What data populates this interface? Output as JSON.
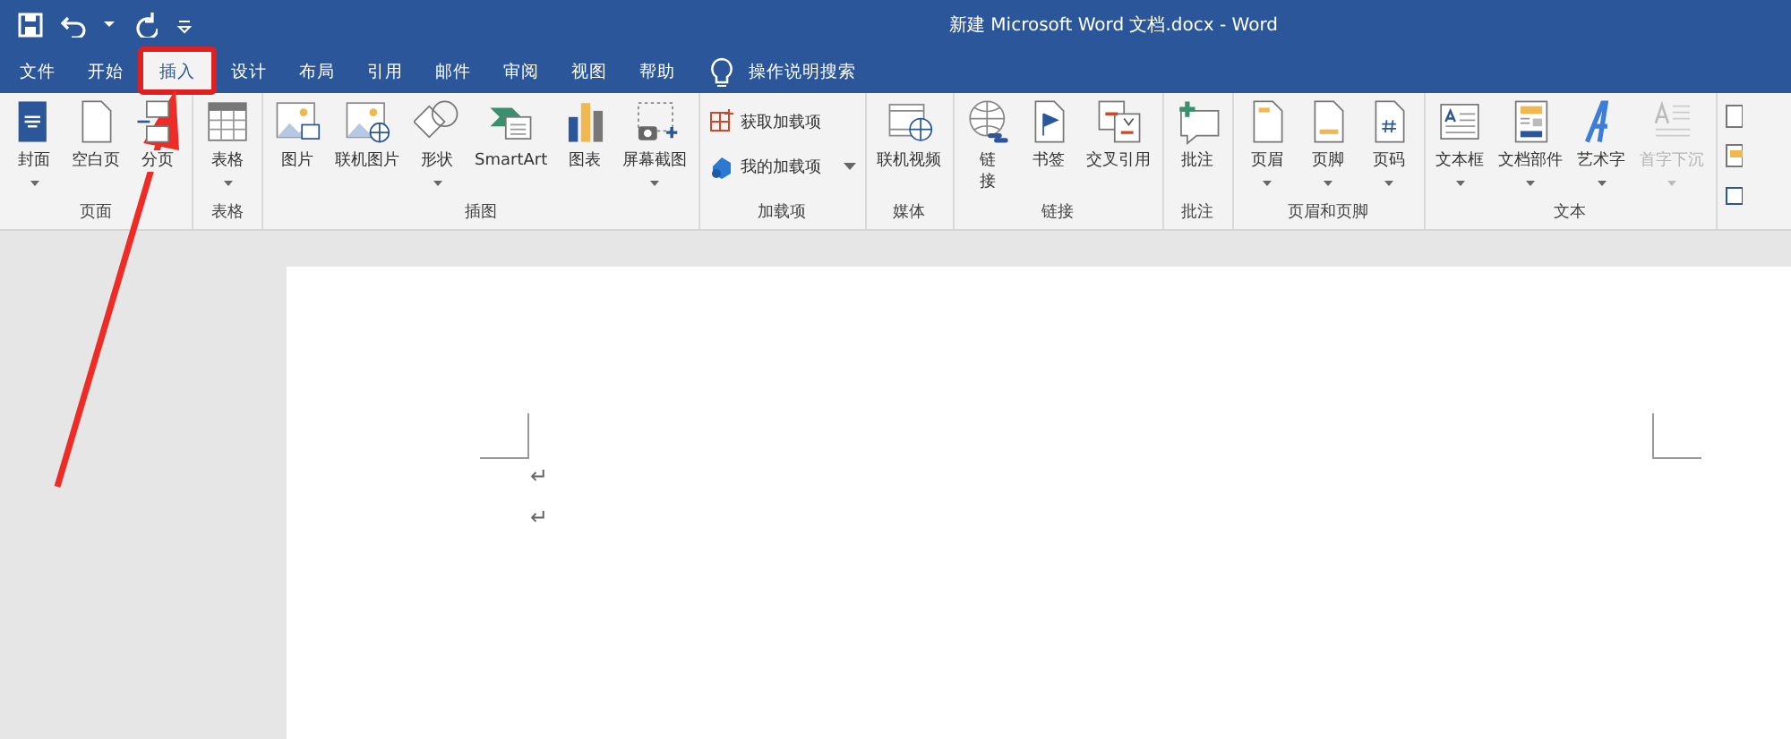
{
  "window": {
    "title": "新建 Microsoft Word 文档.docx  -  Word"
  },
  "tabs": [
    {
      "label": "文件",
      "selected": false,
      "highlighted": false
    },
    {
      "label": "开始",
      "selected": false,
      "highlighted": false
    },
    {
      "label": "插入",
      "selected": true,
      "highlighted": true
    },
    {
      "label": "设计",
      "selected": false,
      "highlighted": false
    },
    {
      "label": "布局",
      "selected": false,
      "highlighted": false
    },
    {
      "label": "引用",
      "selected": false,
      "highlighted": false
    },
    {
      "label": "邮件",
      "selected": false,
      "highlighted": false
    },
    {
      "label": "审阅",
      "selected": false,
      "highlighted": false
    },
    {
      "label": "视图",
      "selected": false,
      "highlighted": false
    },
    {
      "label": "帮助",
      "selected": false,
      "highlighted": false
    }
  ],
  "tell_me": {
    "placeholder": "操作说明搜索"
  },
  "ribbon_groups": [
    {
      "label": "页面",
      "buttons": [
        {
          "kind": "large",
          "label": "封面",
          "dropdown": true,
          "disabled": false
        },
        {
          "kind": "large",
          "label": "空白页",
          "dropdown": false,
          "disabled": false
        },
        {
          "kind": "large",
          "label": "分页",
          "dropdown": false,
          "disabled": false
        }
      ]
    },
    {
      "label": "表格",
      "buttons": [
        {
          "kind": "large",
          "label": "表格",
          "dropdown": true,
          "disabled": false
        }
      ]
    },
    {
      "label": "插图",
      "buttons": [
        {
          "kind": "large",
          "label": "图片",
          "dropdown": false,
          "disabled": false
        },
        {
          "kind": "large",
          "label": "联机图片",
          "dropdown": false,
          "disabled": false
        },
        {
          "kind": "large",
          "label": "形状",
          "dropdown": true,
          "disabled": false
        },
        {
          "kind": "large",
          "label": "SmartArt",
          "dropdown": false,
          "disabled": false
        },
        {
          "kind": "large",
          "label": "图表",
          "dropdown": false,
          "disabled": false
        },
        {
          "kind": "large",
          "label": "屏幕截图",
          "dropdown": true,
          "disabled": false
        }
      ]
    },
    {
      "label": "加载项",
      "buttons": [
        {
          "kind": "small",
          "label": "获取加载项",
          "dropdown": false,
          "disabled": false
        },
        {
          "kind": "small",
          "label": "我的加载项",
          "dropdown": true,
          "disabled": false
        }
      ]
    },
    {
      "label": "媒体",
      "buttons": [
        {
          "kind": "large",
          "label": "联机视频",
          "dropdown": false,
          "disabled": false
        }
      ]
    },
    {
      "label": "链接",
      "buttons": [
        {
          "kind": "stacked",
          "label": "链接",
          "dropdown": false,
          "disabled": false
        },
        {
          "kind": "large",
          "label": "书签",
          "dropdown": false,
          "disabled": false
        },
        {
          "kind": "large",
          "label": "交叉引用",
          "dropdown": false,
          "disabled": false
        }
      ]
    },
    {
      "label": "批注",
      "buttons": [
        {
          "kind": "large",
          "label": "批注",
          "dropdown": false,
          "disabled": false
        }
      ]
    },
    {
      "label": "页眉和页脚",
      "buttons": [
        {
          "kind": "large",
          "label": "页眉",
          "dropdown": true,
          "disabled": false
        },
        {
          "kind": "large",
          "label": "页脚",
          "dropdown": true,
          "disabled": false
        },
        {
          "kind": "large",
          "label": "页码",
          "dropdown": true,
          "disabled": false
        }
      ]
    },
    {
      "label": "文本",
      "buttons": [
        {
          "kind": "large",
          "label": "文本框",
          "dropdown": true,
          "disabled": false
        },
        {
          "kind": "large",
          "label": "文档部件",
          "dropdown": true,
          "disabled": false
        },
        {
          "kind": "large",
          "label": "艺术字",
          "dropdown": true,
          "disabled": false
        },
        {
          "kind": "large",
          "label": "首字下沉",
          "dropdown": true,
          "disabled": true
        }
      ]
    }
  ],
  "document": {
    "paragraphs": [
      "↵",
      "↵"
    ]
  }
}
